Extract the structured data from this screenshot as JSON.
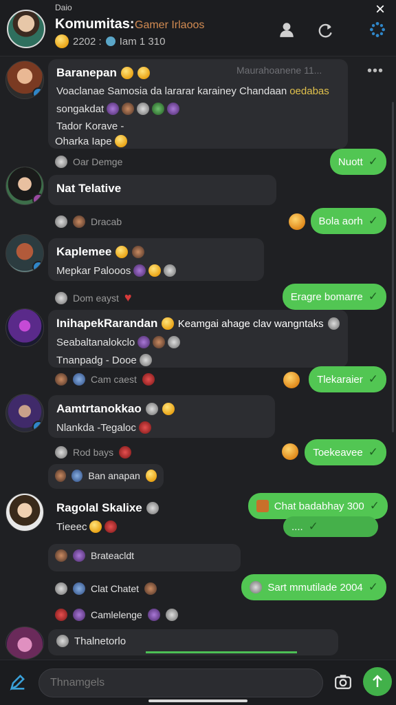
{
  "status": {
    "left": "Daio",
    "right": ""
  },
  "header": {
    "title": "Komumitas:",
    "subtitle": "Gamer Irlaoos",
    "meta_count": "2202 :",
    "meta_tag": "Iam 1 310",
    "close_label": "×"
  },
  "messages": [
    {
      "title": "Baranepan",
      "time": "Maurahoanene 11...",
      "lines": [
        "Voaclanae Samosia da lararar karainey Chandaan",
        "songakdat",
        "Tador Korave -",
        "Oharka Iape"
      ],
      "highlight": "oedabas",
      "meta": "Oar Demge",
      "out": "Nuott"
    },
    {
      "title": "Nat Telative",
      "meta": "Dracab",
      "out": "Bola aorh"
    },
    {
      "title": "Kaplemee",
      "lines": [
        "Mepkar  Palooos"
      ],
      "meta": "Dom eayst",
      "out": "Eragre bomarre"
    },
    {
      "title": "InihapekRarandan",
      "title_rest": "Keamgai ahage clav wangntaks",
      "lines": [
        "Seabaltanalokclo",
        "Tnanpadg - Dooe"
      ],
      "meta": "Cam caest",
      "out": "Tlekaraier"
    },
    {
      "title": "Aamtrtanokkao",
      "lines": [
        "Nlankda -Tegaloc"
      ],
      "meta": "Rod bays",
      "out": "Toekeavee"
    },
    {
      "title": "",
      "meta": "Ban anapan"
    },
    {
      "title": "Ragolal Skalixe",
      "lines": [
        "Tieeec"
      ],
      "out": "Chat badabhay 300",
      "out2": "....",
      "sub_bubble": "Brateacldt",
      "meta": "Clat Chatet",
      "out3": "Sart mmutilade 2004",
      "meta2": "Camlelenge"
    },
    {
      "title": "Thalnetorlo"
    }
  ],
  "composer": {
    "placeholder": "Thnamgels"
  },
  "icons": {
    "header": [
      "person-icon",
      "refresh-icon",
      "more-options-icon"
    ],
    "composer": [
      "attach-icon",
      "camera-icon",
      "send-icon"
    ]
  },
  "colors": {
    "accent": "#52c653",
    "background": "#1f2023",
    "bubble": "#2c2d31"
  }
}
